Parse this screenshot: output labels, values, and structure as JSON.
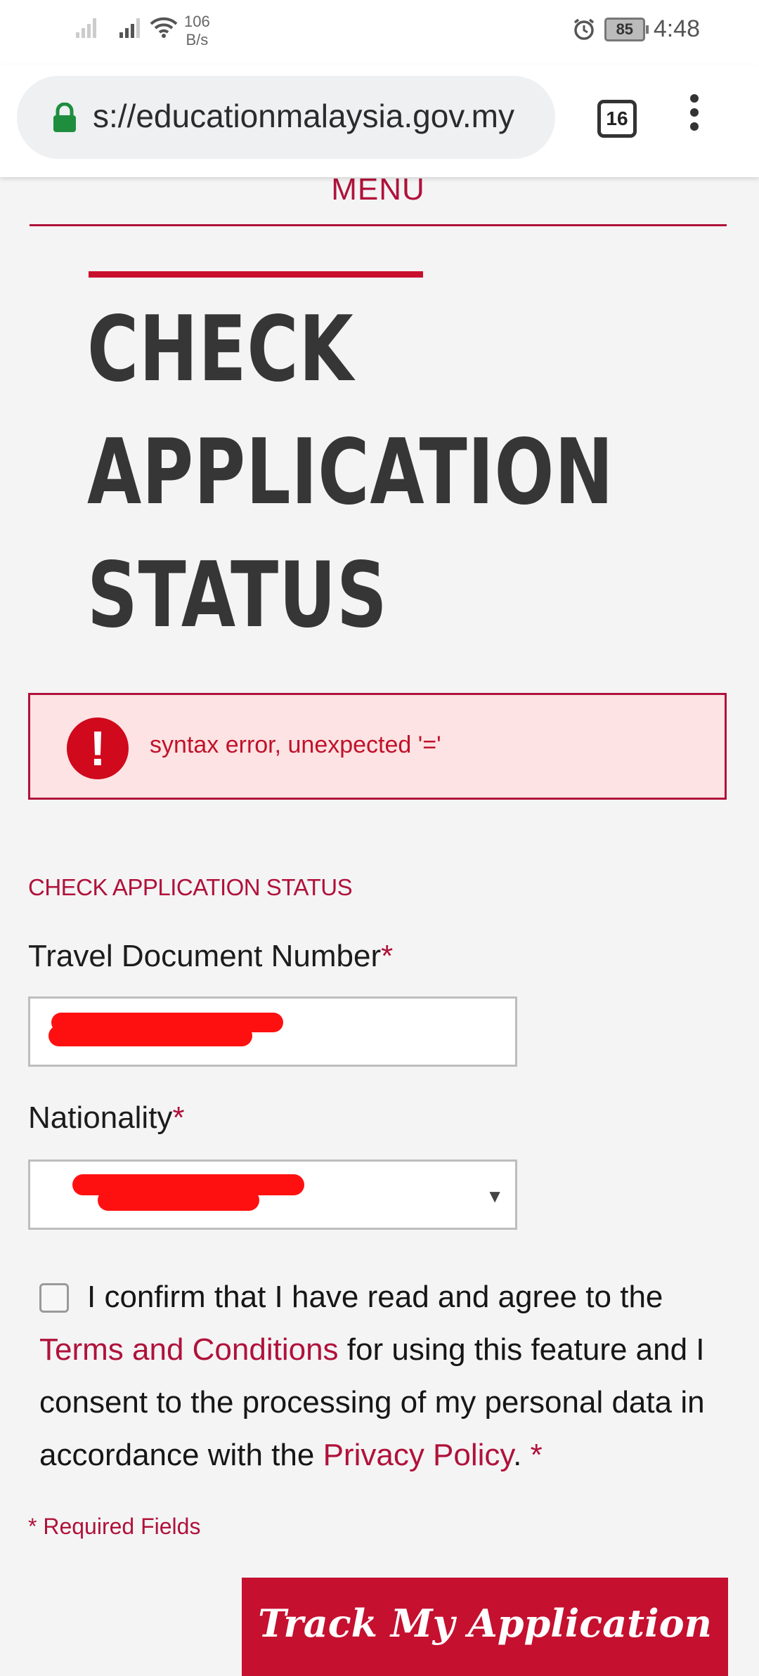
{
  "status_bar": {
    "speed_value": "106",
    "speed_unit": "B/s",
    "battery": "85",
    "time": "4:48"
  },
  "browser": {
    "url": "s://educationmalaysia.gov.my",
    "tab_count": "16"
  },
  "menu_label": "MENU",
  "page_title_lines": [
    "CHECK",
    "APPLICATION",
    "STATUS"
  ],
  "error": {
    "message": "syntax error, unexpected '='",
    "icon": "exclamation-icon",
    "color": "#d0091c"
  },
  "form": {
    "section_label": "CHECK APPLICATION STATUS",
    "travel_doc_label": "Travel Document Number",
    "nationality_label": "Nationality",
    "required_mark": "*",
    "consent_text_1": "I confirm that I have read and agree to the",
    "terms_link": "Terms and Conditions",
    "consent_text_2": "for using this feature and I consent to the processing of my personal data in accordance with the",
    "privacy_link": "Privacy Policy",
    "consent_end": ".",
    "required_note": "* Required Fields",
    "submit_label": "Track My Application"
  },
  "colors": {
    "accent": "#b0123a",
    "button": "#c5102f",
    "redaction": "#ff1010"
  }
}
